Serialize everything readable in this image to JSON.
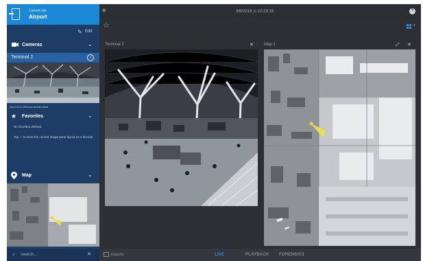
{
  "site": {
    "caption": "Current site",
    "name": "Airport"
  },
  "sidebar": {
    "edit_label": "Edit",
    "cameras_label": "Cameras",
    "selected_camera": "Terminal 2",
    "camera_url": "rtsp://10.0.185/cam/stream/fluid",
    "favorites_label": "Favorites",
    "favorites_empty": "No favorites defined.",
    "favorites_hint": "Tap ☆ to store the current image pane layout as a favorite.",
    "map_label": "Map",
    "search_placeholder": "Search..."
  },
  "topbar": {
    "datetime": "3/8/2019 ◷ 10:23:15"
  },
  "panes": [
    {
      "title": "Terminal 2"
    },
    {
      "title": "Map 1"
    }
  ],
  "bottombar": {
    "exports_label": "Exports",
    "tabs": [
      "LIVE",
      "PLAYBACK",
      "FORENSICS"
    ]
  },
  "colors": {
    "accent": "#1b88d8",
    "sidebar": "#1e3d66",
    "selected_row": "#2961a0",
    "live_tab": "#2f8fe0"
  }
}
